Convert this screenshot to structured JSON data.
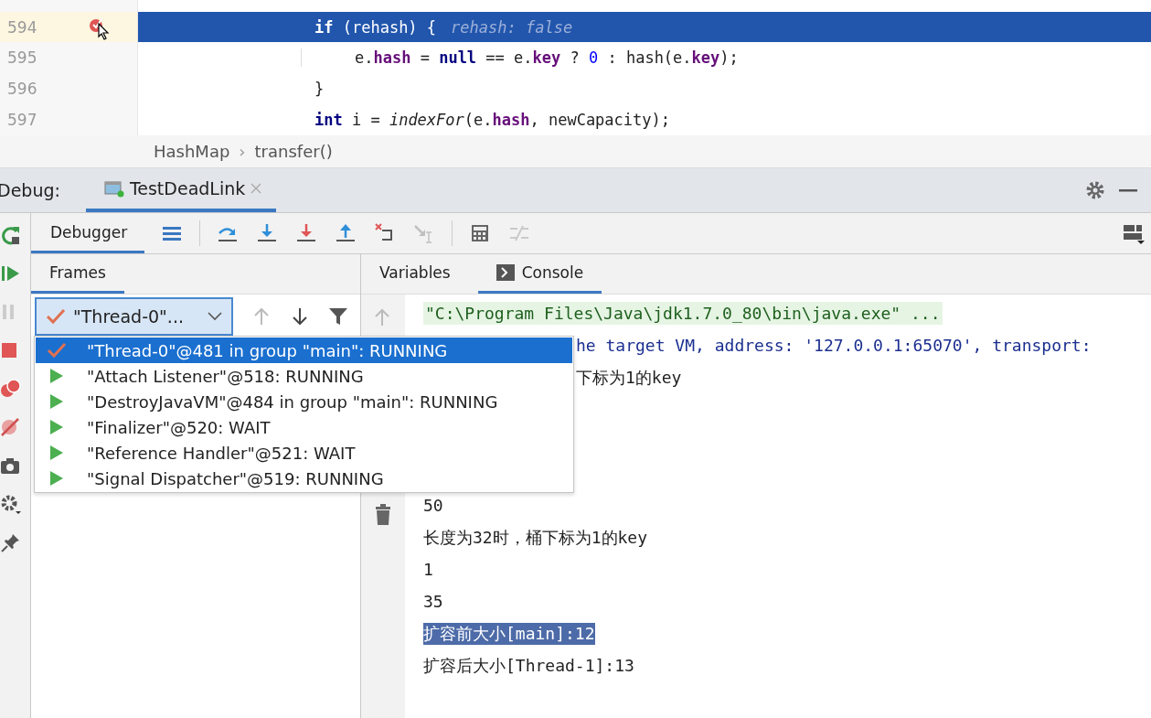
{
  "editor": {
    "lines": [
      {
        "number": "594",
        "current": true,
        "breakpoint": true,
        "nested": false,
        "tokens": [
          {
            "kind": "keyword",
            "text": "if"
          },
          {
            "kind": "plain",
            "text": " (rehash) {"
          }
        ],
        "hint": "rehash: false"
      },
      {
        "number": "595",
        "current": false,
        "breakpoint": false,
        "nested": true,
        "tokens": [
          {
            "kind": "plain",
            "text": "e."
          },
          {
            "kind": "field",
            "text": "hash"
          },
          {
            "kind": "plain",
            "text": " = "
          },
          {
            "kind": "keyword",
            "text": "null"
          },
          {
            "kind": "plain",
            "text": " == e."
          },
          {
            "kind": "field",
            "text": "key"
          },
          {
            "kind": "plain",
            "text": " ? "
          },
          {
            "kind": "number",
            "text": "0"
          },
          {
            "kind": "plain",
            "text": " : hash(e."
          },
          {
            "kind": "field",
            "text": "key"
          },
          {
            "kind": "plain",
            "text": ");"
          }
        ]
      },
      {
        "number": "596",
        "current": false,
        "breakpoint": false,
        "nested": false,
        "tokens": [
          {
            "kind": "plain",
            "text": "}"
          }
        ]
      },
      {
        "number": "597",
        "current": false,
        "breakpoint": false,
        "nested": false,
        "tokens": [
          {
            "kind": "keyword",
            "text": "int"
          },
          {
            "kind": "plain",
            "text": " i = "
          },
          {
            "kind": "method",
            "text": "indexFor"
          },
          {
            "kind": "plain",
            "text": "(e."
          },
          {
            "kind": "field",
            "text": "hash"
          },
          {
            "kind": "plain",
            "text": ", newCapacity);"
          }
        ]
      }
    ]
  },
  "breadcrumb": {
    "items": [
      "HashMap",
      "transfer()"
    ],
    "separator": "›"
  },
  "debug_bar": {
    "label": "Debug:",
    "tab": "TestDeadLink"
  },
  "toolbar": {
    "tab": "Debugger",
    "buttons": [
      {
        "kind": "layout",
        "disabled": false
      },
      {
        "kind": "step-over",
        "disabled": false
      },
      {
        "kind": "step-into",
        "disabled": false
      },
      {
        "kind": "force-step-into",
        "disabled": false
      },
      {
        "kind": "step-out",
        "disabled": false
      },
      {
        "kind": "drop-frame",
        "disabled": false
      },
      {
        "kind": "run-to-cursor",
        "disabled": true
      },
      {
        "kind": "evaluate",
        "disabled": false
      },
      {
        "kind": "trace",
        "disabled": true
      }
    ]
  },
  "side_buttons": [
    {
      "kind": "rerun"
    },
    {
      "kind": "resume"
    },
    {
      "kind": "pause"
    },
    {
      "kind": "stop"
    },
    {
      "kind": "breakpoints"
    },
    {
      "kind": "mute"
    },
    {
      "kind": "camera"
    },
    {
      "kind": "settings"
    },
    {
      "kind": "pin"
    }
  ],
  "frames": {
    "title": "Frames",
    "thread_select": "\"Thread-0\"...",
    "up_disabled": true,
    "down_disabled": false
  },
  "console_tabs": [
    {
      "label": "Variables",
      "selected": false
    },
    {
      "label": "Console",
      "selected": true
    }
  ],
  "thread_popup": [
    {
      "label": "\"Thread-0\"@481 in group \"main\": RUNNING",
      "kind": "check",
      "selected": true
    },
    {
      "label": "\"Attach Listener\"@518: RUNNING",
      "kind": "play",
      "selected": false
    },
    {
      "label": "\"DestroyJavaVM\"@484 in group \"main\": RUNNING",
      "kind": "play",
      "selected": false
    },
    {
      "label": "\"Finalizer\"@520: WAIT",
      "kind": "play",
      "selected": false
    },
    {
      "label": "\"Reference Handler\"@521: WAIT",
      "kind": "play",
      "selected": false
    },
    {
      "label": "\"Signal Dispatcher\"@519: RUNNING",
      "kind": "play",
      "selected": false
    }
  ],
  "console": {
    "first_line": {
      "kind": "command",
      "text": "\"C:\\Program Files\\Java\\jdk1.7.0_80\\bin\\java.exe\" ..."
    },
    "lines_beside_popup": [
      {
        "kind": "info",
        "text": "he target VM, address: '127.0.0.1:65070', transport:"
      },
      {
        "kind": "output",
        "text": "下标为1的key"
      }
    ],
    "lines_below_popup": [
      {
        "kind": "output",
        "text": "50",
        "selected": false
      },
      {
        "kind": "output",
        "text": "长度为32时，桶下标为1的key",
        "selected": false
      },
      {
        "kind": "output",
        "text": "1",
        "selected": false
      },
      {
        "kind": "output",
        "text": "35",
        "selected": false
      },
      {
        "kind": "output",
        "text": "扩容前大小[main]:12",
        "selected": true
      },
      {
        "kind": "output",
        "text": "扩容后大小[Thread-1]:13",
        "selected": false
      }
    ]
  }
}
